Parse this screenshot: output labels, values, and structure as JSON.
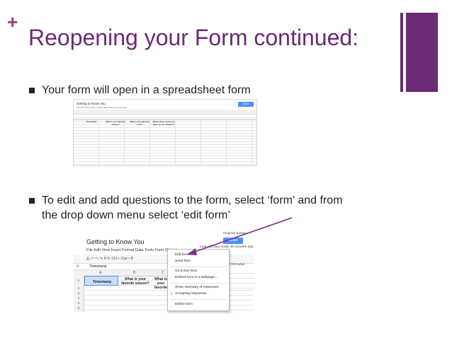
{
  "slide": {
    "plus": "+",
    "title": "Reopening your Form continued:",
    "bullets": [
      "Your form will open in a spreadsheet form",
      "To edit and add questions to the form, select ‘form’ and from",
      "the drop down menu select ‘edit form’"
    ],
    "accent_color": "#6a2b73",
    "plus_color": "#a8397f"
  },
  "screenshot1": {
    "doc_title": "Getting to Know You",
    "menu": "File  Edit  View  Insert  Format  Data  Tools  Form (0)  Help",
    "share": "Share",
    "headers": [
      "Timestamp",
      "What is your favorite season?",
      "What is your favorite food?",
      "Which place would you rather go for vacation?"
    ]
  },
  "screenshot2": {
    "doc_title": "Getting to Know You",
    "menu": "File   Edit   View   Insert   Format   Data   Tools   Form (0)   Help",
    "toolbar": "⎙  ↶  ↷  ✎   $  %  123 ▾   10pt ▾   B",
    "fx": "fx",
    "cell_value": "Timestamp",
    "col_a": "A",
    "col_b": "B",
    "col_c": "C",
    "rows": [
      "1",
      "2",
      "3",
      "4",
      "5",
      "6",
      "7"
    ],
    "header_timestamp": "Timestamp",
    "header_season": "What is your favorite season?",
    "header_c": "What is your favorite",
    "user": "meghan.bowen",
    "share": "Share",
    "last_edit": "Last edit was made 46 minutes ago",
    "formulas": "d formulas"
  },
  "dropdown": {
    "items": [
      "Edit form",
      "Send form",
      "Go to live form",
      "Embed form in a webpage...",
      "Show summary of responses",
      "Accepting responses",
      "Delete form"
    ],
    "checkmark": "✓"
  }
}
